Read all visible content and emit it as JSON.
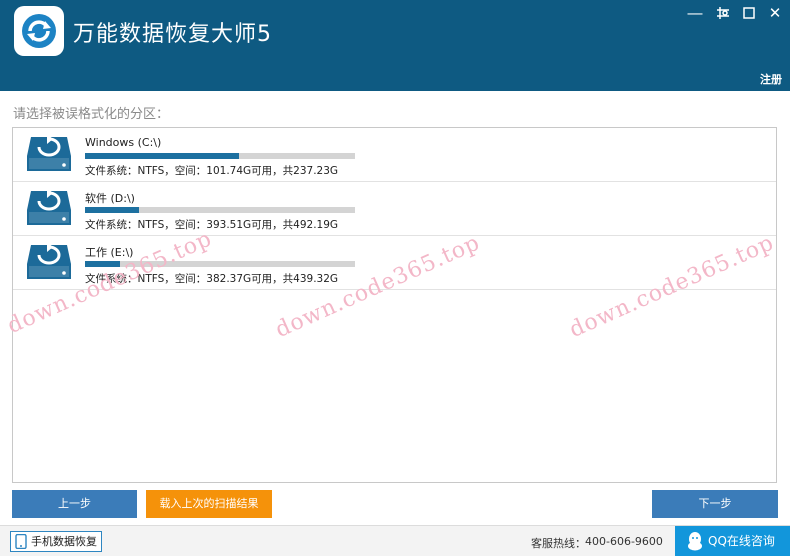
{
  "app": {
    "title": "万能数据恢复大师5"
  },
  "window_controls": {
    "minimize": "―",
    "restore": "❐",
    "close": "✕"
  },
  "header": {
    "register_label": "注册"
  },
  "prompt": "请选择被误格式化的分区：",
  "partitions": [
    {
      "name": "Windows (C:\\)",
      "info": "文件系统：NTFS，空间：101.74G可用，共237.23G",
      "used_fraction": 0.57
    },
    {
      "name": "软件 (D:\\)",
      "info": "文件系统：NTFS，空间：393.51G可用，共492.19G",
      "used_fraction": 0.2
    },
    {
      "name": "工作 (E:\\)",
      "info": "文件系统：NTFS，空间：382.37G可用，共439.32G",
      "used_fraction": 0.13
    }
  ],
  "buttons": {
    "prev": "上一步",
    "load": "载入上次的扫描结果",
    "next": "下一步"
  },
  "footer": {
    "mobile_recovery": "手机数据恢复",
    "hotline_label": "客服热线：",
    "hotline_number": "400-606-9600",
    "qq_consult": "QQ在线咨询"
  },
  "watermark": "down.code365.top",
  "colors": {
    "titlebar": "#0e5a82",
    "accent": "#1d70a0",
    "orange": "#f5920a",
    "button_blue": "#3b7cb9",
    "qq": "#1296db"
  },
  "icons": {
    "logo": "refresh-icon",
    "disk": "disk-restore-icon",
    "phone": "phone-icon",
    "qq": "qq-penguin-icon"
  }
}
